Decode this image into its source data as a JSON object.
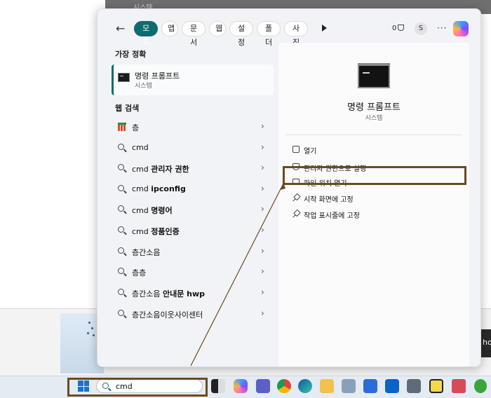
{
  "background": {
    "ghost_text": "시스템",
    "side_text": "ho"
  },
  "filters": {
    "items": [
      {
        "label": "모두",
        "active": true
      },
      {
        "label": "앱"
      },
      {
        "label": "문서"
      },
      {
        "label": "웹"
      },
      {
        "label": "설정"
      },
      {
        "label": "폴더"
      },
      {
        "label": "사진"
      }
    ],
    "points": "0",
    "avatar": "S"
  },
  "best_match": {
    "title": "가장 정확",
    "name": "명령 프롬프트",
    "type": "시스템"
  },
  "web_search": {
    "title": "웹 검색",
    "items": [
      {
        "text": "층"
      },
      {
        "text": "cmd"
      },
      {
        "prefix": "cmd",
        "bold": "관리자 권한"
      },
      {
        "prefix": "cmd",
        "bold": "ipconfig"
      },
      {
        "prefix": "cmd",
        "bold": "명령어"
      },
      {
        "prefix": "cmd",
        "bold": "정품인증"
      },
      {
        "text": "층간소음"
      },
      {
        "text": "층층"
      },
      {
        "prefix": "층간소음",
        "bold": "안내문 hwp"
      },
      {
        "text": "층간소음이웃사이센터"
      }
    ]
  },
  "details": {
    "name": "명령 프롬프트",
    "type": "시스템",
    "actions": [
      {
        "label": "열기",
        "icon": "open-icon"
      },
      {
        "label": "관리자 권한으로 실행",
        "icon": "shield-icon"
      },
      {
        "label": "파일 위치 열기",
        "icon": "folder-icon"
      },
      {
        "label": "시작 화면에 고정",
        "icon": "pin-icon"
      },
      {
        "label": "작업 표시줄에 고정",
        "icon": "pin-icon"
      }
    ]
  },
  "taskbar": {
    "search_value": "cmd",
    "apps": [
      "task-view-icon",
      "copilot-icon",
      "teams-icon",
      "chrome-icon",
      "edge-icon",
      "file-explorer-icon",
      "network-icon",
      "store-icon",
      "outlook-icon",
      "calculator-icon",
      "sticky-notes-icon",
      "snipping-tool-icon",
      "torrent-icon"
    ]
  }
}
